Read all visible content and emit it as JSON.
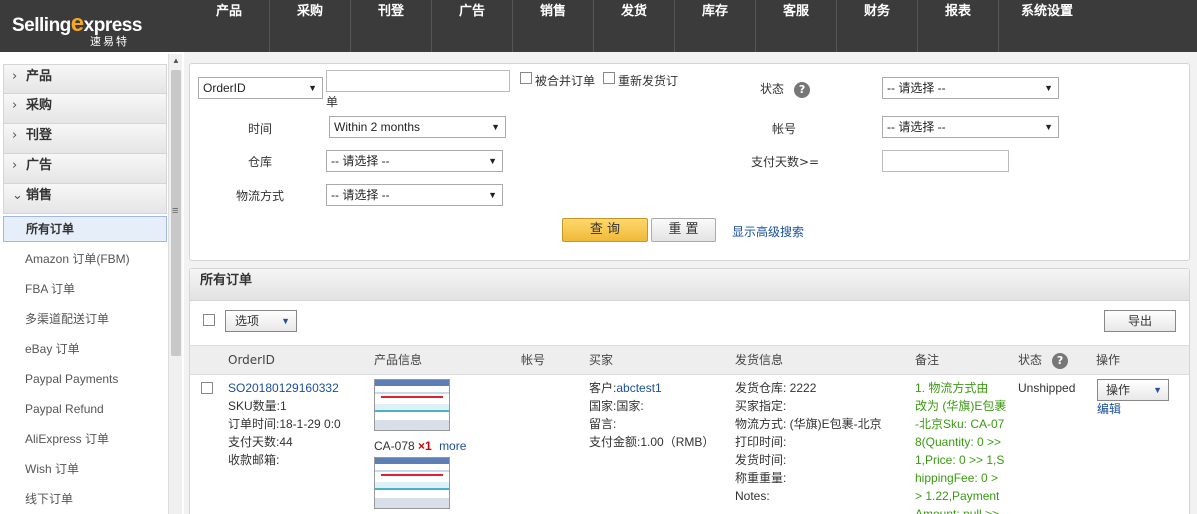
{
  "logo": {
    "brand_left": "Selling",
    "brand_x": "e",
    "brand_right": "xpress",
    "sub": "速易特"
  },
  "nav": [
    "产品",
    "采购",
    "刊登",
    "广告",
    "销售",
    "发货",
    "库存",
    "客服",
    "财务",
    "报表",
    "系统设置"
  ],
  "sidebar": {
    "sections": [
      {
        "label": "产品",
        "arrow": "›"
      },
      {
        "label": "采购",
        "arrow": "›"
      },
      {
        "label": "刊登",
        "arrow": "›"
      },
      {
        "label": "广告",
        "arrow": "›"
      },
      {
        "label": "销售",
        "arrow": "⌄"
      }
    ],
    "items": [
      "所有订单",
      "Amazon 订单(FBM)",
      "FBA 订单",
      "多渠道配送订单",
      "eBay 订单",
      "Paypal Payments",
      "Paypal Refund",
      "AliExpress 订单",
      "Wish 订单",
      "线下订单"
    ],
    "drag_handle": "≡"
  },
  "search": {
    "field_select": "OrderID",
    "field_suffix": "单",
    "chk_merged": "被合并订单",
    "chk_resend": "重新发货订",
    "status_label": "状态",
    "status_value": "-- 请选择 --",
    "time_label": "时间",
    "time_value": "Within 2 months",
    "account_label": "帐号",
    "account_value": "-- 请选择 --",
    "warehouse_label": "仓库",
    "warehouse_value": "-- 请选择 --",
    "paydays_label": "支付天数>=",
    "paydays_value": "",
    "shipping_label": "物流方式",
    "shipping_value": "-- 请选择 --",
    "query_btn": "查 询",
    "reset_btn": "重 置",
    "advanced_link": "显示高级搜索"
  },
  "orders": {
    "title": "所有订单",
    "options_btn": "选项",
    "export_btn": "导出",
    "columns": [
      "OrderID",
      "产品信息",
      "帐号",
      "买家",
      "发货信息",
      "备注",
      "状态",
      "操作"
    ],
    "row": {
      "order_id": "SO20180129160332",
      "sku_count": "SKU数量:1",
      "order_time": "订单时间:18-1-29 0:0",
      "pay_days": "支付天数:44",
      "pay_email": "收款邮箱:",
      "product_sku": "CA-078",
      "product_qty": "×1",
      "product_more": "more",
      "buyer_prefix": "客户:",
      "buyer_name": "abctest1",
      "buyer_country": "国家:国家:",
      "buyer_msg": "留言:",
      "buyer_amount": "支付金额:1.00（RMB）",
      "ship_warehouse": "发货仓库: 2222",
      "ship_buyer_spec": "买家指定:",
      "ship_method": "物流方式: (华旗)E包裹-北京",
      "ship_print": "打印时间:",
      "ship_time": "发货时间:",
      "ship_weight": "称重重量:",
      "ship_notes": "Notes:",
      "remark_lines": [
        "1.  物流方式由",
        "改为 (华旗)E包裹",
        "-北京Sku: CA-07",
        "8(Quantity: 0 >>",
        "1,Price: 0 >> 1,S",
        "hippingFee: 0 >",
        "> 1.22,Payment",
        "Amount: null >>"
      ],
      "status": "Unshipped",
      "action_select": "操作",
      "edit_link": "编辑"
    }
  }
}
